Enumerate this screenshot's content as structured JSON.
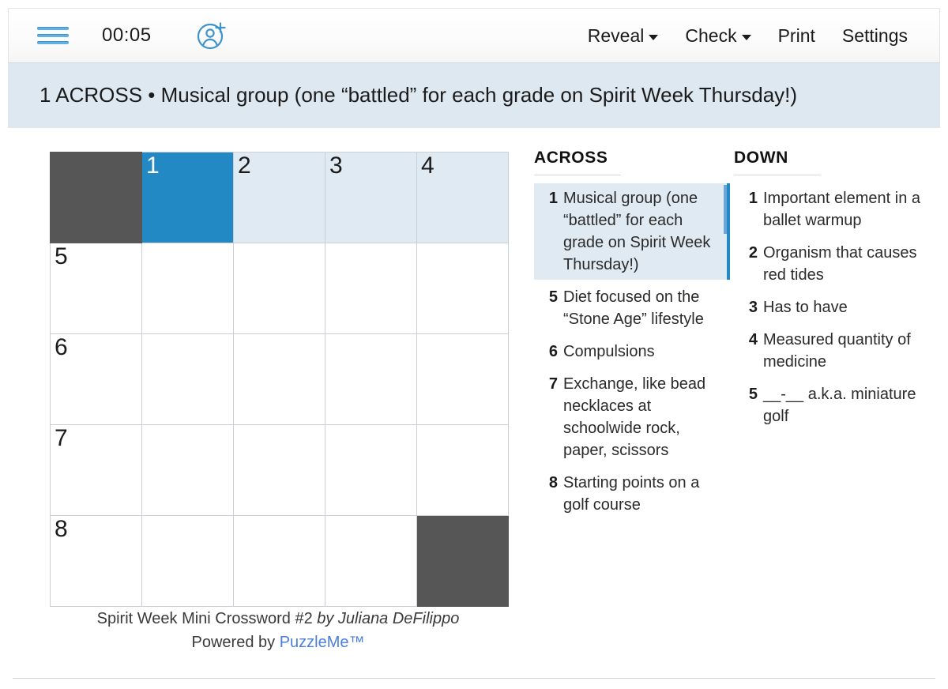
{
  "toolbar": {
    "menu_icon": "hamburger-menu-icon",
    "timer": "00:05",
    "add_user_icon": "add-user-icon",
    "items": [
      {
        "label": "Reveal",
        "has_caret": true
      },
      {
        "label": "Check",
        "has_caret": true
      },
      {
        "label": "Print",
        "has_caret": false
      },
      {
        "label": "Settings",
        "has_caret": false
      }
    ]
  },
  "current_clue": {
    "text": "1 ACROSS • Musical group (one “battled” for each grade on Spirit Week Thursday!)"
  },
  "grid": {
    "rows": 5,
    "cols": 5,
    "selected_cell": {
      "row": 0,
      "col": 1
    },
    "cells": [
      [
        {
          "type": "block"
        },
        {
          "type": "cell",
          "number": "1",
          "state": "selected"
        },
        {
          "type": "cell",
          "number": "2",
          "state": "highlight"
        },
        {
          "type": "cell",
          "number": "3",
          "state": "highlight"
        },
        {
          "type": "cell",
          "number": "4",
          "state": "highlight"
        }
      ],
      [
        {
          "type": "cell",
          "number": "5",
          "state": "normal"
        },
        {
          "type": "cell",
          "number": "",
          "state": "normal"
        },
        {
          "type": "cell",
          "number": "",
          "state": "normal"
        },
        {
          "type": "cell",
          "number": "",
          "state": "normal"
        },
        {
          "type": "cell",
          "number": "",
          "state": "normal"
        }
      ],
      [
        {
          "type": "cell",
          "number": "6",
          "state": "normal"
        },
        {
          "type": "cell",
          "number": "",
          "state": "normal"
        },
        {
          "type": "cell",
          "number": "",
          "state": "normal"
        },
        {
          "type": "cell",
          "number": "",
          "state": "normal"
        },
        {
          "type": "cell",
          "number": "",
          "state": "normal"
        }
      ],
      [
        {
          "type": "cell",
          "number": "7",
          "state": "normal"
        },
        {
          "type": "cell",
          "number": "",
          "state": "normal"
        },
        {
          "type": "cell",
          "number": "",
          "state": "normal"
        },
        {
          "type": "cell",
          "number": "",
          "state": "normal"
        },
        {
          "type": "cell",
          "number": "",
          "state": "normal"
        }
      ],
      [
        {
          "type": "cell",
          "number": "8",
          "state": "normal"
        },
        {
          "type": "cell",
          "number": "",
          "state": "normal"
        },
        {
          "type": "cell",
          "number": "",
          "state": "normal"
        },
        {
          "type": "cell",
          "number": "",
          "state": "normal"
        },
        {
          "type": "block"
        }
      ]
    ]
  },
  "puzzle_footer": {
    "title": "Spirit Week Mini Crossword #2",
    "byline": "by Juliana DeFilippo",
    "powered_prefix": "Powered by",
    "powered_link": "PuzzleMe™"
  },
  "clues": {
    "across": {
      "heading": "ACROSS",
      "items": [
        {
          "num": "1",
          "text": "Musical group (one “battled” for each grade on Spirit Week Thursday!)",
          "active": true
        },
        {
          "num": "5",
          "text": "Diet focused on the “Stone Age” lifestyle",
          "active": false
        },
        {
          "num": "6",
          "text": "Compulsions",
          "active": false
        },
        {
          "num": "7",
          "text": "Exchange, like bead necklaces at schoolwide rock, paper, scissors",
          "active": false
        },
        {
          "num": "8",
          "text": "Starting points on a golf course",
          "active": false
        }
      ]
    },
    "down": {
      "heading": "DOWN",
      "items": [
        {
          "num": "1",
          "text": "Important element in a ballet warmup",
          "active": true
        },
        {
          "num": "2",
          "text": "Organism that causes red tides",
          "active": false
        },
        {
          "num": "3",
          "text": "Has to have",
          "active": false
        },
        {
          "num": "4",
          "text": "Measured quantity of medicine",
          "active": false
        },
        {
          "num": "5",
          "text": "__-__ a.k.a. miniature golf",
          "active": false
        }
      ]
    }
  },
  "colors": {
    "selected_cell": "#2389c4",
    "highlight_cell": "#dfeaf2",
    "block_cell": "#565656",
    "clue_bar_bg": "#dde8f0",
    "accent_blue": "#63b0e0",
    "link_blue": "#4a7fe0"
  }
}
